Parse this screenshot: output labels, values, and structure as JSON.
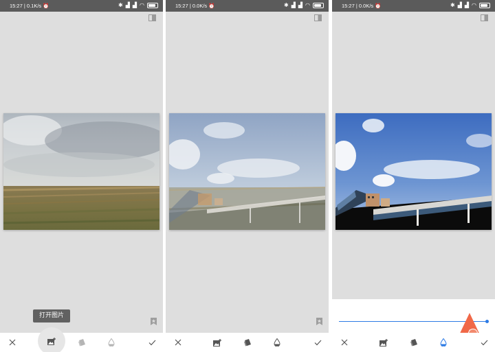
{
  "panels": [
    {
      "status": {
        "time": "15:27",
        "speed": "0.1K/s"
      },
      "tooltip": "打开图片"
    },
    {
      "status": {
        "time": "15:27",
        "speed": "0.0K/s"
      }
    },
    {
      "status": {
        "time": "15:27",
        "speed": "0.0K/s"
      }
    }
  ],
  "slider": {
    "value": 1.0
  },
  "icons": {
    "close": "close-icon",
    "add_image": "add-image-icon",
    "layer": "layer-icon",
    "drop": "drop-icon",
    "check": "check-icon",
    "compare": "compare-icon",
    "bookmark": "bookmark-icon"
  },
  "colors": {
    "accent": "#2d7be5",
    "watermark": "#f06848",
    "panel_bg": "#dedede"
  }
}
